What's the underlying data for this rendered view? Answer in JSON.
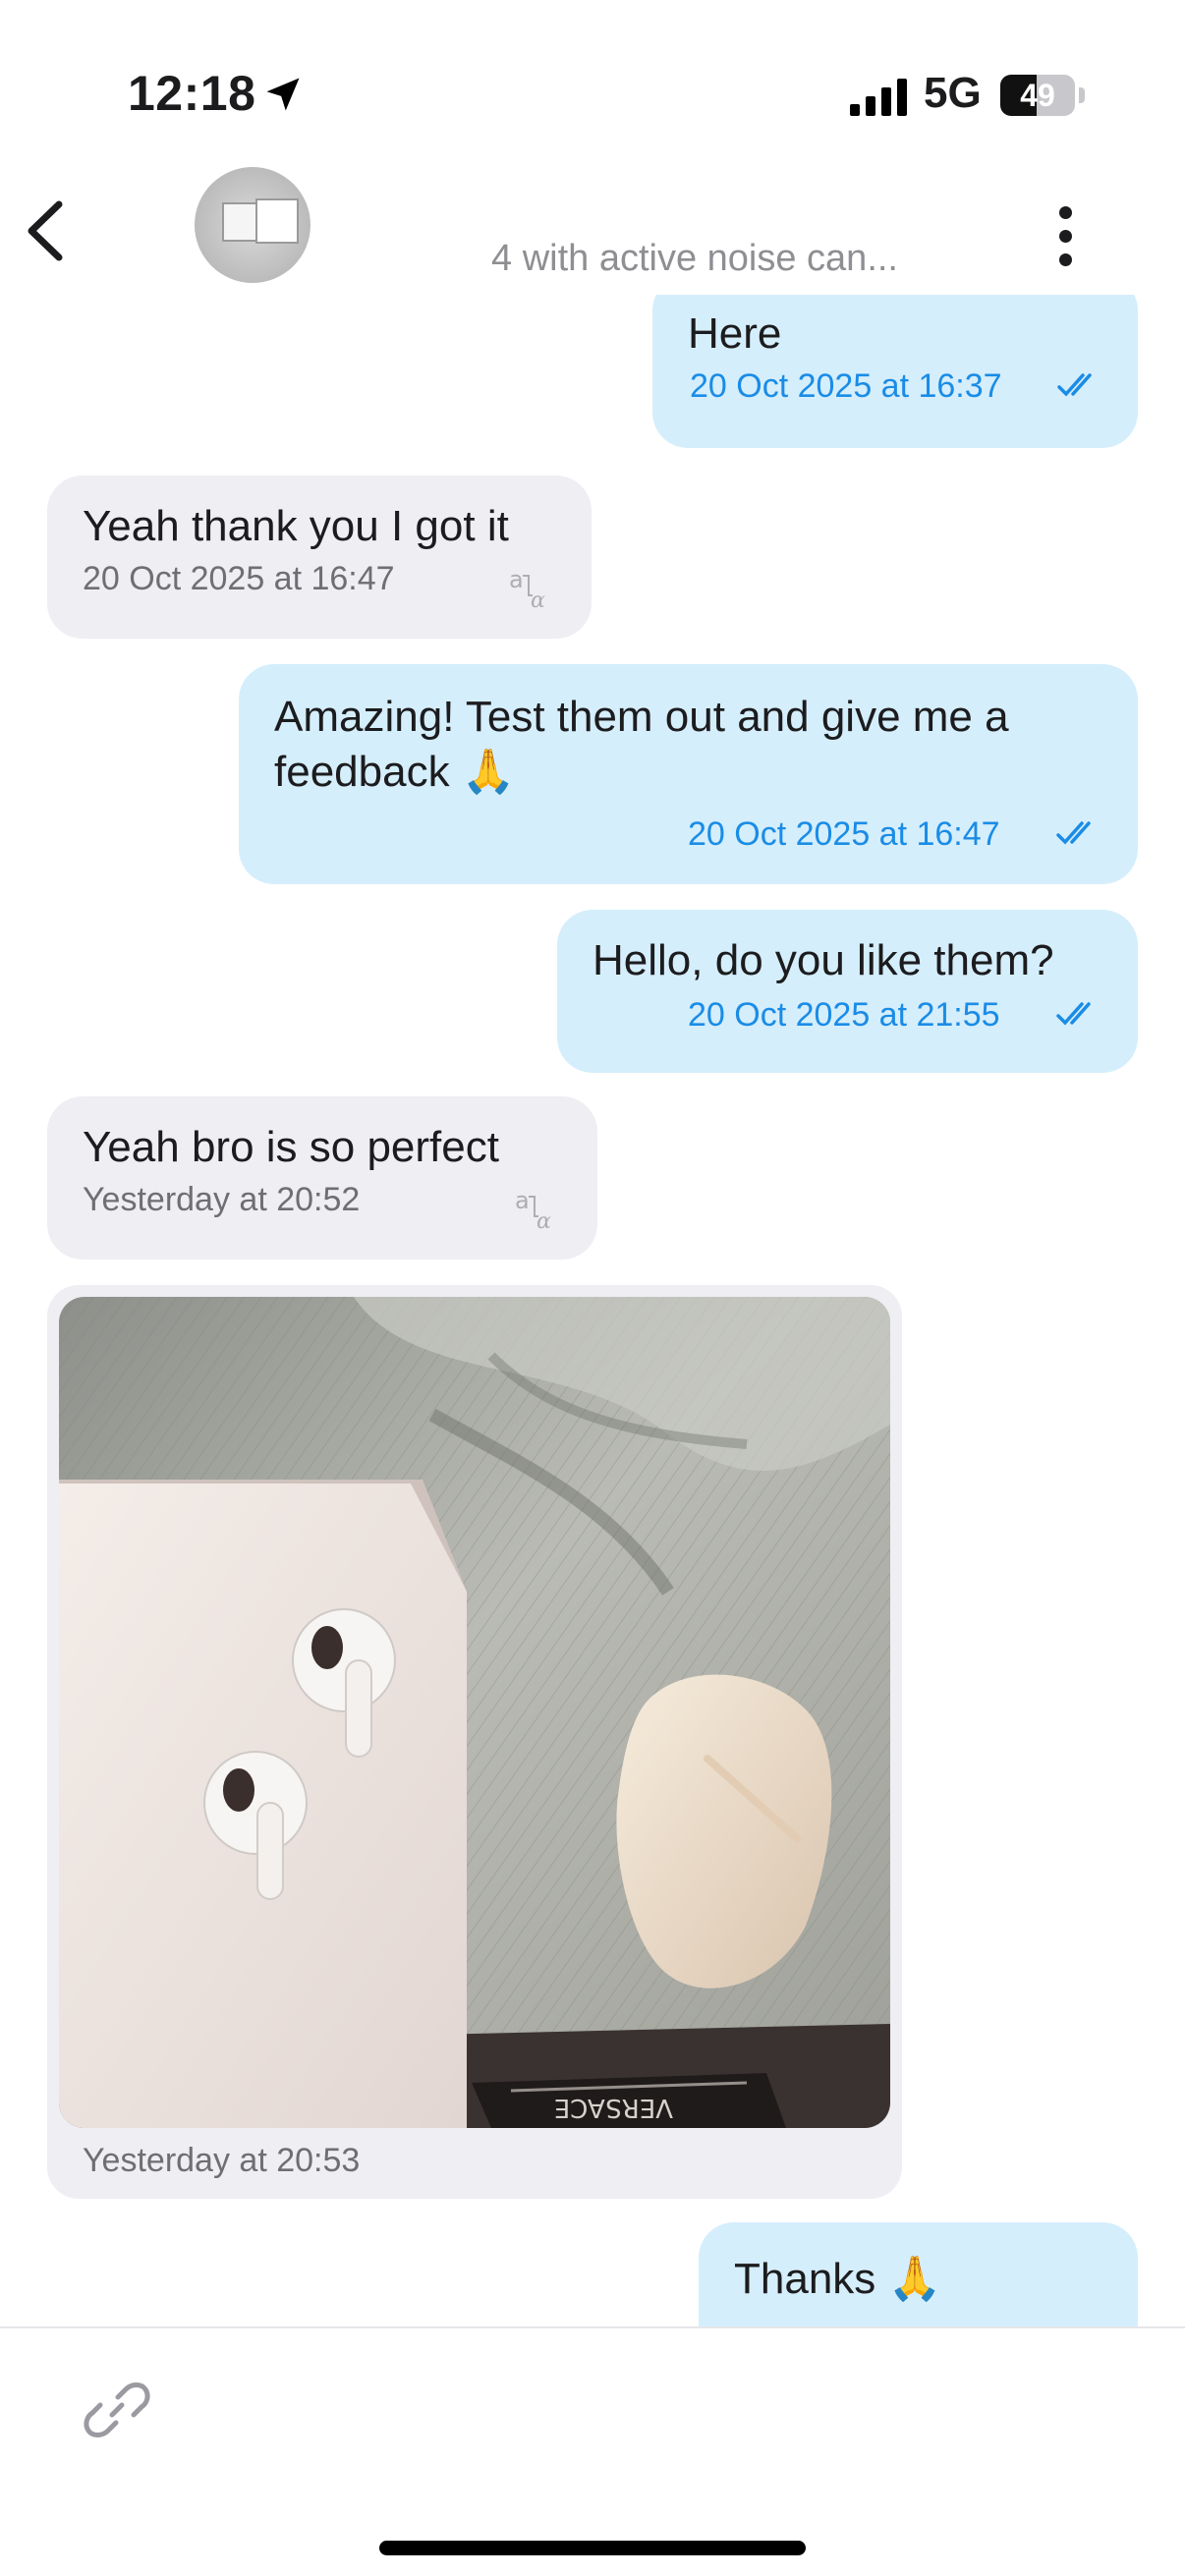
{
  "status_bar": {
    "time": "12:18",
    "network": "5G",
    "battery": "49",
    "battery_level": 0.49,
    "icons": [
      "location-arrow-icon",
      "cellular-signal-icon",
      "battery-icon"
    ]
  },
  "header": {
    "subtitle": "4 with active noise can...",
    "icons": [
      "chevron-left-icon",
      "more-vertical-icon"
    ]
  },
  "messages": [
    {
      "direction": "out",
      "text": "Here",
      "time": "20 Oct 2025 at 16:37",
      "read": true
    },
    {
      "direction": "in",
      "text": "Yeah thank you I got it",
      "time": "20 Oct 2025 at 16:47",
      "icon": "translate-icon"
    },
    {
      "direction": "out",
      "text_lines": [
        "Amazing! Test them out and give me a",
        "feedback 🙏"
      ],
      "time": "20 Oct 2025 at 16:47",
      "read": true
    },
    {
      "direction": "out",
      "text": "Hello, do you like them?",
      "time": "20 Oct 2025 at 21:55",
      "read": true
    },
    {
      "direction": "in",
      "text": "Yeah bro is so perfect",
      "time": "Yesterday at 20:52",
      "icon": "translate-icon"
    },
    {
      "direction": "in",
      "type": "image",
      "image_description": "photo-airpods-box-and-case",
      "image_caption_text": "VERSACE",
      "time": "Yesterday at 20:53"
    },
    {
      "direction": "out",
      "text": "Thanks 🙏"
    }
  ],
  "composer": {
    "icons": [
      "link-icon"
    ]
  },
  "colors": {
    "outgoing_bubble": "#d5eefc",
    "incoming_bubble": "#eeeef3",
    "outgoing_time": "#1a8ce6",
    "incoming_time": "#6e6e73"
  }
}
